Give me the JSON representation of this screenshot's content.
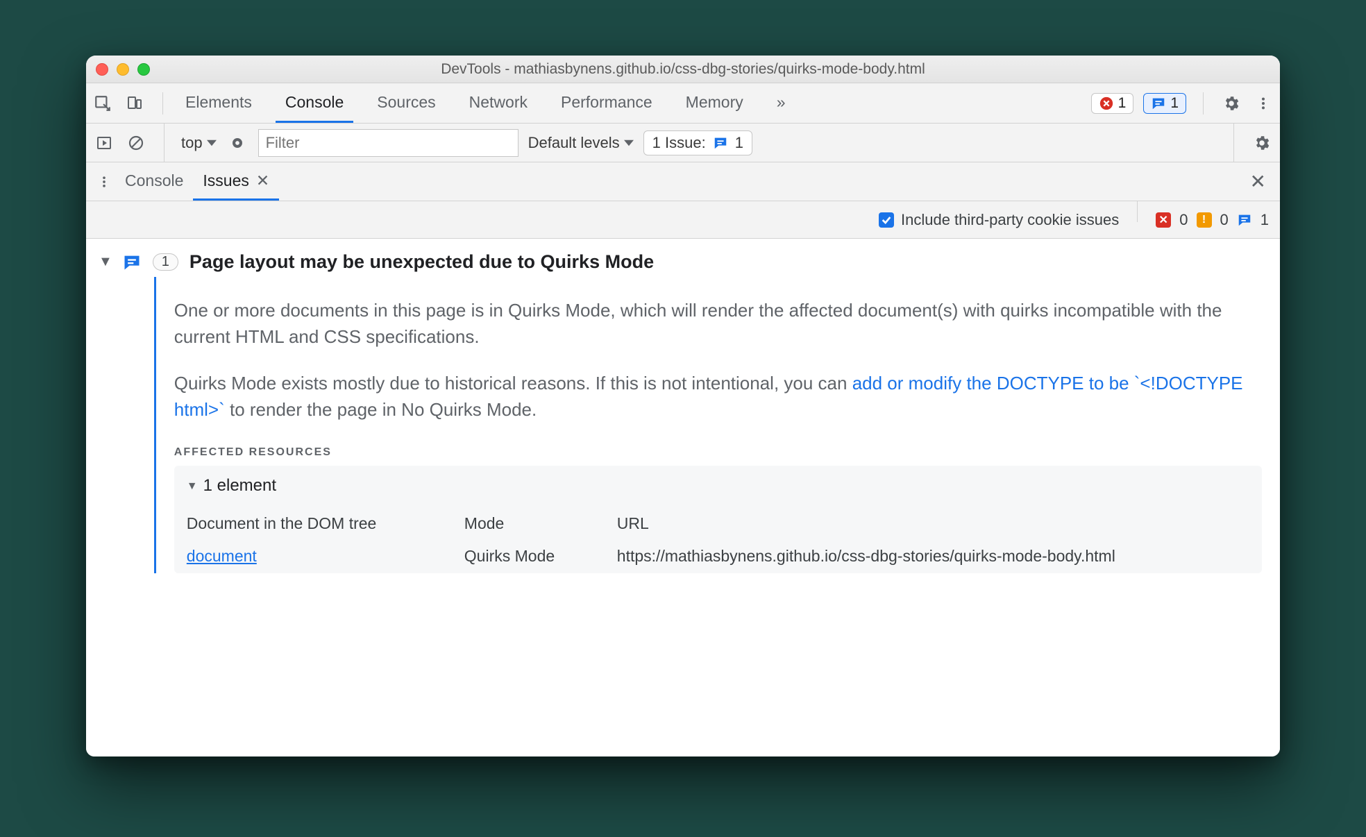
{
  "window_title": "DevTools - mathiasbynens.github.io/css-dbg-stories/quirks-mode-body.html",
  "tabs": {
    "items": [
      "Elements",
      "Console",
      "Sources",
      "Network",
      "Performance",
      "Memory"
    ],
    "active": "Console",
    "overflow": "»"
  },
  "top_badges": {
    "errors": "1",
    "issues": "1"
  },
  "console_toolbar": {
    "context": "top",
    "filter_placeholder": "Filter",
    "levels": "Default levels",
    "issues_label": "1 Issue:",
    "issues_count": "1"
  },
  "drawer": {
    "tabs": [
      "Console",
      "Issues"
    ],
    "active": "Issues"
  },
  "issues_toolbar": {
    "include_third_party": "Include third-party cookie issues",
    "counts": {
      "errors": "0",
      "warnings": "0",
      "info": "1"
    }
  },
  "issue": {
    "count": "1",
    "title": "Page layout may be unexpected due to Quirks Mode",
    "para1": "One or more documents in this page is in Quirks Mode, which will render the affected document(s) with quirks incompatible with the current HTML and CSS specifications.",
    "para2_pre": "Quirks Mode exists mostly due to historical reasons. If this is not intentional, you can ",
    "para2_link": "add or modify the DOCTYPE to be `<!DOCTYPE html>`",
    "para2_post": " to render the page in No Quirks Mode.",
    "affected_heading": "AFFECTED RESOURCES",
    "affected_count": "1 element",
    "columns": {
      "c1": "Document in the DOM tree",
      "c2": "Mode",
      "c3": "URL"
    },
    "row": {
      "c1": "document",
      "c2": "Quirks Mode",
      "c3": "https://mathiasbynens.github.io/css-dbg-stories/quirks-mode-body.html"
    }
  }
}
